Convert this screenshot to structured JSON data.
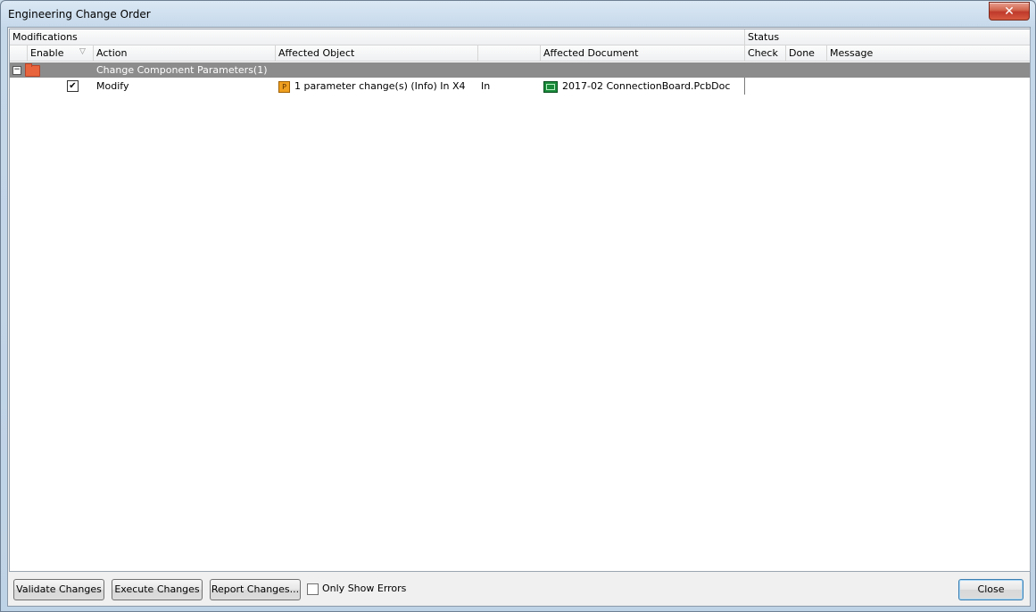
{
  "window": {
    "title": "Engineering Change Order",
    "close_glyph": "✕"
  },
  "header": {
    "modifications": "Modifications",
    "status": "Status",
    "columns": {
      "enable": "Enable",
      "action": "Action",
      "affected_object": "Affected Object",
      "affected_document": "Affected Document",
      "check": "Check",
      "done": "Done",
      "message": "Message"
    }
  },
  "group": {
    "expander": "−",
    "label": "Change Component Parameters(1)"
  },
  "rows": [
    {
      "enabled": "✔",
      "action": "Modify",
      "object_icon": "P",
      "affected_object": "1 parameter change(s) (Info) In X4",
      "relation": "In",
      "affected_document": "2017-02 ConnectionBoard.PcbDoc"
    }
  ],
  "buttons": {
    "validate": "Validate Changes",
    "execute": "Execute Changes",
    "report": "Report Changes...",
    "close": "Close"
  },
  "options": {
    "only_show_errors": "Only Show Errors"
  },
  "colors": {
    "group_row": "#8c8c8c",
    "pcb_icon": "#1a8a3a",
    "param_icon": "#f0a020",
    "folder": "#e8643c"
  }
}
